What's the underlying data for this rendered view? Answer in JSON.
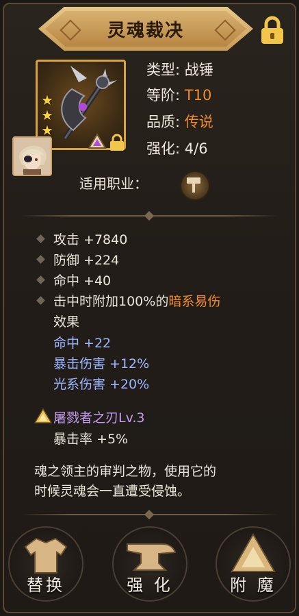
{
  "title": "灵魂裁决",
  "item": {
    "stars": 3,
    "type_label": "类型:",
    "type_value": "战锤",
    "tier_label": "等阶:",
    "tier_value": "T10",
    "quality_label": "品质:",
    "quality_value": "传说",
    "enhance_label": "强化:",
    "enhance_value": "4/6"
  },
  "job": {
    "label": "适用职业：",
    "icon": "hammer-icon"
  },
  "stats": [
    "攻击 +7840",
    "防御 +224",
    "命中 +40"
  ],
  "special": {
    "prefix": "击中时附加100%的",
    "highlight": "暗系易伤",
    "suffix": "效果"
  },
  "bonus_stats": [
    "命中 +22",
    "暴击伤害 +12%",
    "光系伤害 +20%"
  ],
  "skill": {
    "name": "屠戮者之刃Lv.3",
    "effect": "暴击率 +5%"
  },
  "description": [
    "魂之领主的审判之物，使用它的",
    "时候灵魂会一直遭受侵蚀。"
  ],
  "buttons": {
    "replace": "替换",
    "enhance": "强 化",
    "enchant": "附 魔"
  },
  "colors": {
    "gold": "#d9a43f",
    "orange": "#f28c2b",
    "blue": "#9cb6ff",
    "purple": "#c49cf2"
  }
}
